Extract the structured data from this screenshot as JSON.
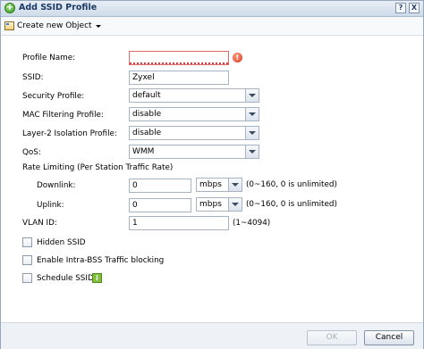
{
  "dialog": {
    "title": "Add SSID Profile",
    "help_label": "?",
    "close_label": "X"
  },
  "toolbar": {
    "create_new_object_label": "Create new Object"
  },
  "form": {
    "profile_name_label": "Profile Name:",
    "profile_name_value": "",
    "ssid_label": "SSID:",
    "ssid_value": "Zyxel",
    "security_profile_label": "Security Profile:",
    "security_profile_value": "default",
    "mac_filtering_label": "MAC Filtering Profile:",
    "mac_filtering_value": "disable",
    "l2_isolation_label": "Layer-2 Isolation Profile:",
    "l2_isolation_value": "disable",
    "qos_label": "QoS:",
    "qos_value": "WMM",
    "rate_limiting_label": "Rate Limiting (Per Station Traffic Rate)",
    "downlink_label": "Downlink:",
    "downlink_value": "0",
    "downlink_unit": "mbps",
    "downlink_hint": "(0~160, 0 is unlimited)",
    "uplink_label": "Uplink:",
    "uplink_value": "0",
    "uplink_unit": "mbps",
    "uplink_hint": "(0~160, 0 is unlimited)",
    "vlan_label": "VLAN ID:",
    "vlan_value": "1",
    "vlan_hint": "(1~4094)",
    "hidden_ssid_label": "Hidden SSID",
    "intra_bss_label": "Enable Intra-BSS Traffic blocking",
    "schedule_ssid_label": "Schedule SSID",
    "error_icon_glyph": "!",
    "info_icon_glyph": "i"
  },
  "footer": {
    "ok_label": "OK",
    "cancel_label": "Cancel"
  }
}
